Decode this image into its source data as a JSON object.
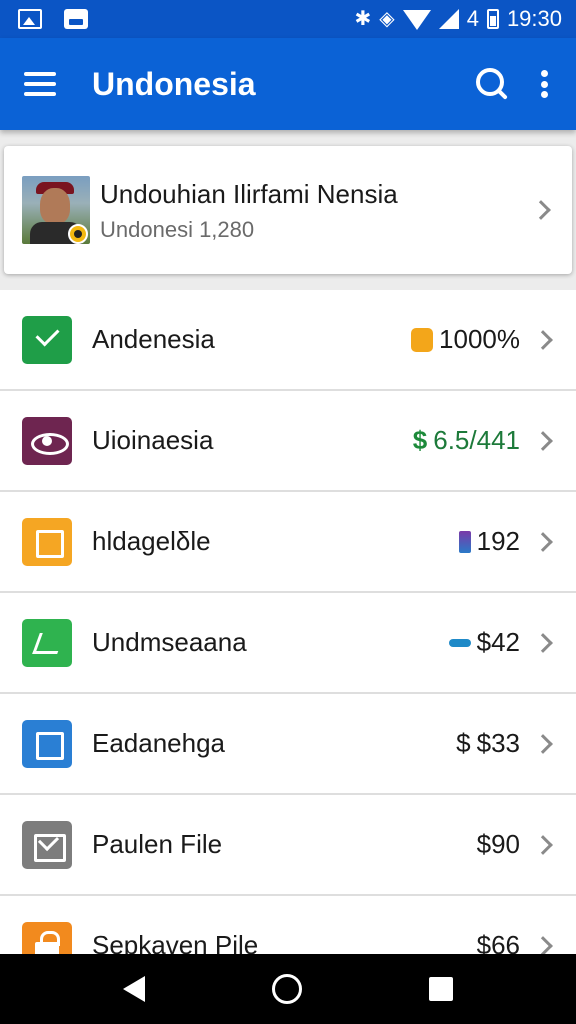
{
  "status_bar": {
    "signal_number": "4",
    "time": "19:30"
  },
  "app_bar": {
    "title": "Undonesia",
    "accent_color": "#0b62d6"
  },
  "profile": {
    "name": "Undouhian Ilirfami Nensia",
    "subtitle": "Undonesi 1,280"
  },
  "items": [
    {
      "label": "Andenesia",
      "value": "1000%",
      "icon": "check-icon",
      "icon_color": "#1f9e48",
      "value_icon": "lock-icon"
    },
    {
      "label": "Uioinaesia",
      "value": "6.5/441",
      "icon": "eye-icon",
      "icon_color": "#6e2550",
      "value_icon": "dollar-icon",
      "value_icon_text": "$"
    },
    {
      "label": "hldagelδle",
      "value": "192",
      "icon": "square-icon",
      "icon_color": "#f5a623",
      "value_icon": "bar-icon"
    },
    {
      "label": "Undmseaana",
      "value": "$42",
      "icon": "flag-icon",
      "icon_color": "#2fb34f",
      "value_icon": "pill-icon"
    },
    {
      "label": "Eadanehga",
      "value": "$33",
      "icon": "square-icon",
      "icon_color": "#2a7fd4",
      "value_icon": "dollar-icon",
      "value_icon_text": "$"
    },
    {
      "label": "Paulen File",
      "value": "$90",
      "icon": "mail-icon",
      "icon_color": "#7d7d7d"
    },
    {
      "label": "Sepkaven Pile",
      "value": "$66",
      "icon": "lock-icon",
      "icon_color": "#f28a1e"
    }
  ]
}
